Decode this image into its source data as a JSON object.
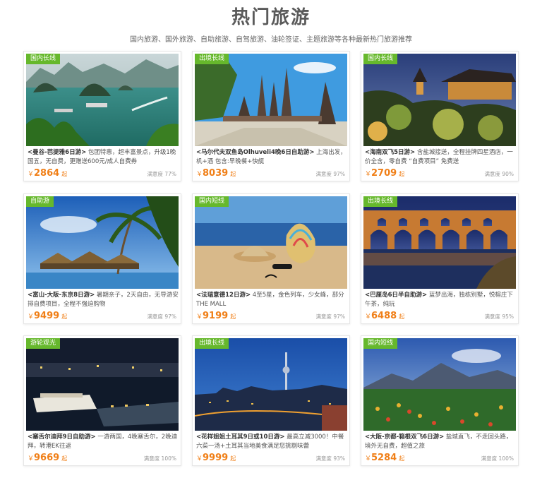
{
  "header": {
    "title": "热门旅游",
    "subtitle": "国内旅游、国外旅游、自助旅游、自驾旅游、油轮签证、主题旅游等各种最新热门旅游推荐"
  },
  "colors": {
    "tag": "#66b82c",
    "price": "#f07f17"
  },
  "currency": "￥",
  "price_suffix": "起",
  "cards": [
    {
      "tag": "国内长线",
      "name": "<曼谷-芭提雅6日游>",
      "desc": " 包团特惠，超丰富景点，升级1晚国五，无自费，更赠送600元/成人自费券",
      "price": "2864",
      "satisfaction": "满意度 77%"
    },
    {
      "tag": "出境长线",
      "name": "<马尔代夫双鱼岛Olhuveli4晚6日自助游>",
      "desc": " 上海出发，机+酒 包含:早晚餐+快艇",
      "price": "8039",
      "satisfaction": "满意度 97%"
    },
    {
      "tag": "国内长线",
      "name": "<海南双飞5日游>",
      "desc": " 含盐城接送，全程挂牌四星酒店，一价全含，零自费 “自费项目” 免费送",
      "price": "2709",
      "satisfaction": "满意度 90%"
    },
    {
      "tag": "自助游",
      "name": "<富山-大阪-东京8日游>",
      "desc": " 暑期亲子，2天自由，无导游安排自费项目，全程不强迫购物",
      "price": "9499",
      "satisfaction": "满意度 97%"
    },
    {
      "tag": "国内短线",
      "name": "<法瑞意德12日游>",
      "desc": " 4至5星，金色列车，少女峰，部分THE MALL",
      "price": "9199",
      "satisfaction": "满意度 97%"
    },
    {
      "tag": "出境长线",
      "name": "<巴厘岛6日半自助游>",
      "desc": " 蓝梦出海，独栋别墅，悦榕庄下午茶，纯玩",
      "price": "6488",
      "satisfaction": "满意度 95%"
    },
    {
      "tag": "游轮观光",
      "name": "<塞舌尔迪拜9日自助游>",
      "desc": " 一游两国，4晚塞舌尔，2晚迪拜，转港EK往返",
      "price": "9669",
      "satisfaction": "满意度 100%"
    },
    {
      "tag": "出境长线",
      "name": "<花样姐姐土耳其9日或10日游>",
      "desc": " 最高立减3000！中餐六菜一汤+土耳其当地美食满足您挑剔味蕾",
      "price": "9999",
      "satisfaction": "满意度 93%"
    },
    {
      "tag": "国内短线",
      "name": "<大阪-京都-箱根双飞6日游>",
      "desc": " 盐城直飞，不走回头路，境外无自费，超值之旅",
      "price": "5284",
      "satisfaction": "满意度 100%"
    }
  ]
}
